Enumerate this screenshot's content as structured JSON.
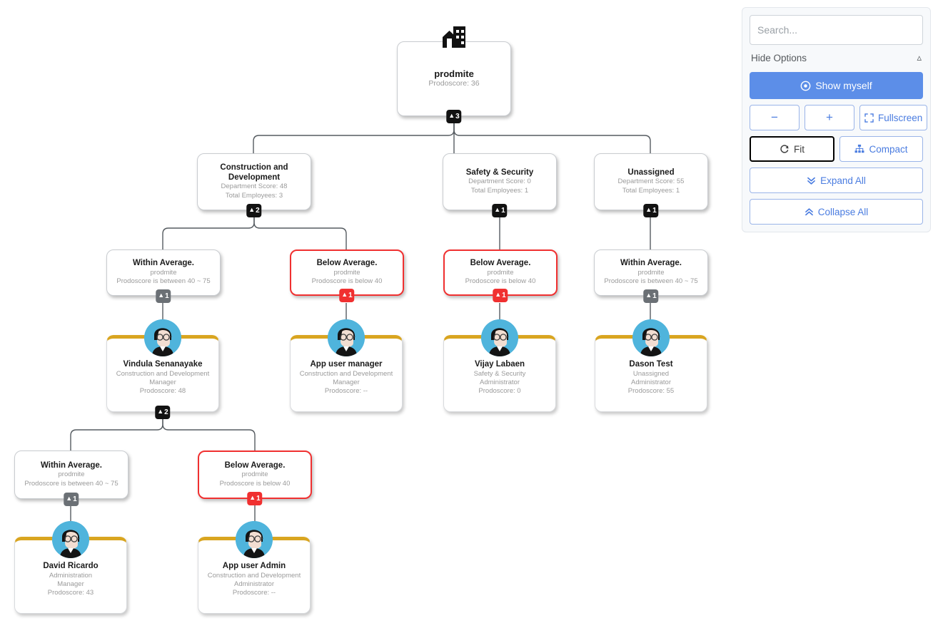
{
  "panel": {
    "search_placeholder": "Search...",
    "search_value": "",
    "hide_options_label": "Hide Options",
    "show_myself_label": "Show myself",
    "zoom_out_label": "−",
    "zoom_in_label": "+",
    "fullscreen_label": "Fullscreen",
    "fit_label": "Fit",
    "compact_label": "Compact",
    "expand_all_label": "Expand All",
    "collapse_all_label": "Collapse All",
    "accent_color": "#5c8ee8"
  },
  "chart": {
    "colors": {
      "badge_dark": "#121212",
      "badge_grey": "#6b7075",
      "badge_red": "#f03030",
      "card_top_bar": "#d9a520",
      "avatar_bg": "#4fb4dc",
      "danger_border": "#f03030",
      "link": "#555b60"
    },
    "root": {
      "icon": "building-icon",
      "title": "prodmite",
      "sub1": "Prodoscore: 36",
      "badge": "3",
      "badge_style": "dark"
    },
    "departments": [
      {
        "title": "Construction and Development",
        "sub1": "Department Score: 48",
        "sub2": "Total Employees: 3",
        "badge": "2",
        "badge_style": "dark"
      },
      {
        "title": "Safety & Security",
        "sub1": "Department Score: 0",
        "sub2": "Total Employees: 1",
        "badge": "1",
        "badge_style": "dark"
      },
      {
        "title": "Unassigned",
        "sub1": "Department Score: 55",
        "sub2": "Total Employees: 1",
        "badge": "1",
        "badge_style": "dark"
      }
    ],
    "criteria": [
      {
        "title": "Within Average.",
        "sub1": "prodmite",
        "sub2": "Prodoscore is between 40 ~ 75",
        "badge": "1",
        "badge_style": "grey",
        "danger": false
      },
      {
        "title": "Below Average.",
        "sub1": "prodmite",
        "sub2": "Prodoscore is below 40",
        "badge": "1",
        "badge_style": "red",
        "danger": true
      },
      {
        "title": "Below Average.",
        "sub1": "prodmite",
        "sub2": "Prodoscore is below 40",
        "badge": "1",
        "badge_style": "red",
        "danger": true
      },
      {
        "title": "Within Average.",
        "sub1": "prodmite",
        "sub2": "Prodoscore is between 40 ~ 75",
        "badge": "1",
        "badge_style": "grey",
        "danger": false
      },
      {
        "title": "Within Average.",
        "sub1": "prodmite",
        "sub2": "Prodoscore is between 40 ~ 75",
        "badge": "1",
        "badge_style": "grey",
        "danger": false
      },
      {
        "title": "Below Average.",
        "sub1": "prodmite",
        "sub2": "Prodoscore is below 40",
        "badge": "1",
        "badge_style": "red",
        "danger": true
      }
    ],
    "people": [
      {
        "name": "Vindula Senanayake",
        "dept": "Construction and Development",
        "role": "Manager",
        "score": "Prodoscore: 48",
        "badge": "2",
        "badge_style": "dark"
      },
      {
        "name": "App user manager",
        "dept": "Construction and Development",
        "role": "Manager",
        "score": "Prodoscore: --",
        "badge": "",
        "badge_style": ""
      },
      {
        "name": "Vijay Labaen",
        "dept": "Safety & Security",
        "role": "Administrator",
        "score": "Prodoscore: 0",
        "badge": "",
        "badge_style": ""
      },
      {
        "name": "Dason Test",
        "dept": "Unassigned",
        "role": "Administrator",
        "score": "Prodoscore: 55",
        "badge": "",
        "badge_style": ""
      },
      {
        "name": "David Ricardo",
        "dept": "Administration",
        "role": "Manager",
        "score": "Prodoscore: 43",
        "badge": "",
        "badge_style": ""
      },
      {
        "name": "App user Admin",
        "dept": "Construction and Development",
        "role": "Administrator",
        "score": "Prodoscore: --",
        "badge": "",
        "badge_style": ""
      }
    ]
  }
}
